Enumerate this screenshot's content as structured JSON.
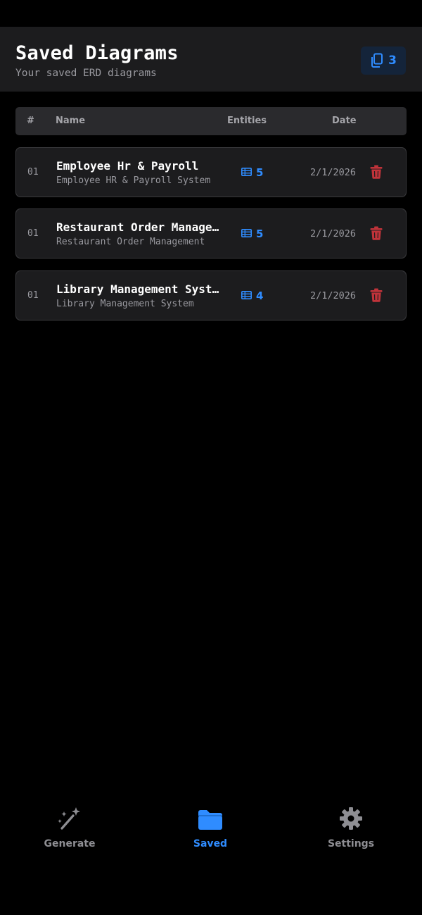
{
  "header": {
    "title": "Saved Diagrams",
    "subtitle": "Your saved ERD diagrams",
    "count": "3",
    "count_icon": "documents-icon"
  },
  "table": {
    "columns": {
      "num": "#",
      "name": "Name",
      "entities": "Entities",
      "date": "Date"
    },
    "rows": [
      {
        "num": "01",
        "title": "Employee Hr & Payroll",
        "description": "Employee HR & Payroll System",
        "entities": "5",
        "date": "2/1/2026"
      },
      {
        "num": "01",
        "title": "Restaurant Order Management",
        "description": "Restaurant Order Management",
        "entities": "5",
        "date": "2/1/2026"
      },
      {
        "num": "01",
        "title": "Library Management System",
        "description": "Library Management System",
        "entities": "4",
        "date": "2/1/2026"
      }
    ]
  },
  "tabbar": {
    "items": [
      {
        "label": "Generate",
        "icon": "magic-wand-icon",
        "active": false
      },
      {
        "label": "Saved",
        "icon": "folder-icon",
        "active": true
      },
      {
        "label": "Settings",
        "icon": "gear-icon",
        "active": false
      }
    ]
  },
  "colors": {
    "accent": "#2f8cff",
    "danger": "#c0333a",
    "background": "#000000",
    "surface": "#1c1c1e"
  }
}
